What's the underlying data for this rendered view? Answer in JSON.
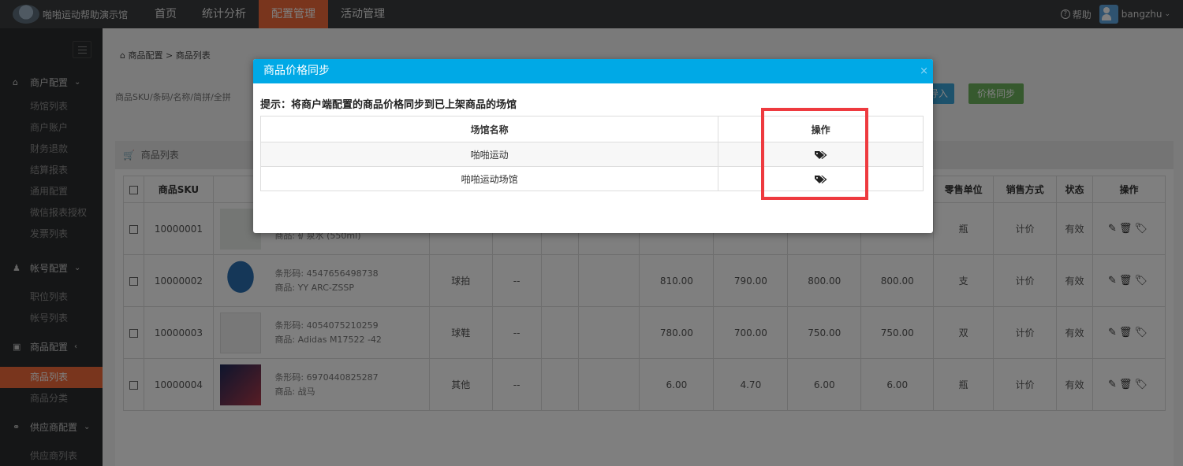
{
  "app": {
    "title": "啪啪运动帮助演示馆"
  },
  "nav": [
    {
      "label": "首页",
      "active": false
    },
    {
      "label": "统计分析",
      "active": false
    },
    {
      "label": "配置管理",
      "active": true
    },
    {
      "label": "活动管理",
      "active": false
    }
  ],
  "top_right": {
    "help": "帮助",
    "user": "bangzhu"
  },
  "sidebar": {
    "groups": [
      {
        "label": "商户配置",
        "icon": "home-icon",
        "items": [
          "场馆列表",
          "商户账户",
          "财务退款",
          "结算报表",
          "通用配置",
          "微信报表授权",
          "发票列表"
        ]
      },
      {
        "label": "帐号配置",
        "icon": "user-icon",
        "items": [
          "职位列表",
          "帐号列表"
        ]
      },
      {
        "label": "商品配置",
        "icon": "gift-icon",
        "items": [
          "商品列表",
          "商品分类"
        ],
        "active_item": "商品列表"
      },
      {
        "label": "供应商配置",
        "icon": "link-icon",
        "items": [
          "供应商列表"
        ]
      }
    ]
  },
  "breadcrumb": {
    "part1": "商品配置",
    "sep": ">",
    "part2": "商品列表"
  },
  "search": {
    "placeholder": "商品SKU/条码/名称/简拼/全拼"
  },
  "buttons": {
    "import": "导入",
    "price_sync": "价格同步"
  },
  "list": {
    "title": "商品列表",
    "headers": [
      "",
      "商品SKU",
      "",
      "",
      "",
      "",
      "",
      "",
      "",
      "",
      "",
      "零售单位",
      "销售方式",
      "状态",
      "操作"
    ],
    "rows": [
      {
        "sku": "10000001",
        "barcode": "",
        "name": "商品: 矿泉水 (550ml)",
        "category": "",
        "dash": "",
        "p1": "",
        "p2": "",
        "p3": "",
        "p4": "",
        "unit": "瓶",
        "mode": "计价",
        "status": "有效"
      },
      {
        "sku": "10000002",
        "barcode": "条形码: 4547656498738",
        "name": "商品: YY ARC-ZSSP",
        "category": "球拍",
        "dash": "--",
        "p1": "810.00",
        "p2": "790.00",
        "p3": "800.00",
        "p4": "800.00",
        "unit": "支",
        "mode": "计价",
        "status": "有效"
      },
      {
        "sku": "10000003",
        "barcode": "条形码: 4054075210259",
        "name": "商品: Adidas M17522 -42",
        "category": "球鞋",
        "dash": "--",
        "p1": "780.00",
        "p2": "700.00",
        "p3": "750.00",
        "p4": "750.00",
        "unit": "双",
        "mode": "计价",
        "status": "有效"
      },
      {
        "sku": "10000004",
        "barcode": "条形码: 6970440825287",
        "name": "商品: 战马",
        "category": "其他",
        "dash": "--",
        "p1": "6.00",
        "p2": "4.70",
        "p3": "6.00",
        "p4": "6.00",
        "unit": "瓶",
        "mode": "计价",
        "status": "有效"
      }
    ]
  },
  "modal": {
    "title": "商品价格同步",
    "close": "×",
    "tip": "提示：将商户端配置的商品价格同步到已上架商品的场馆",
    "headers": [
      "场馆名称",
      "操作"
    ],
    "rows": [
      {
        "venue": "啪啪运动"
      },
      {
        "venue": "啪啪运动场馆"
      }
    ]
  },
  "colors": {
    "accent": "#f26b3a",
    "modal_header": "#00a9e6",
    "highlight": "#ee3a3f"
  }
}
